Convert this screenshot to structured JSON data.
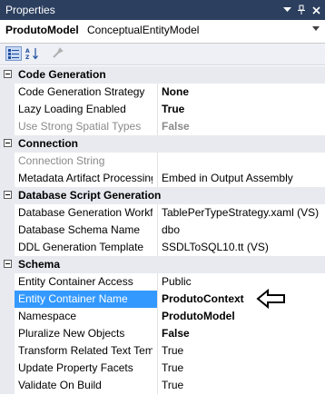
{
  "window": {
    "title": "Properties",
    "icons": [
      "dropdown-icon",
      "pin-icon",
      "close-icon"
    ]
  },
  "object": {
    "name": "ProdutoModel",
    "type": "ConceptualEntityModel"
  },
  "toolbar": {
    "buttons": [
      "categorized-icon",
      "alphabetical-icon",
      "property-pages-icon"
    ]
  },
  "categories": [
    {
      "label": "Code Generation",
      "props": [
        {
          "name": "Code Generation Strategy",
          "value": "None",
          "bold": true
        },
        {
          "name": "Lazy Loading Enabled",
          "value": "True",
          "bold": true
        },
        {
          "name": "Use Strong Spatial Types",
          "value": "False",
          "bold": true,
          "disabled": true
        }
      ]
    },
    {
      "label": "Connection",
      "props": [
        {
          "name": "Connection String",
          "value": "",
          "disabled": true
        },
        {
          "name": "Metadata Artifact Processing",
          "value": "Embed in Output Assembly"
        }
      ]
    },
    {
      "label": "Database Script Generation",
      "props": [
        {
          "name": "Database Generation Workflo",
          "value": "TablePerTypeStrategy.xaml (VS)"
        },
        {
          "name": "Database Schema Name",
          "value": "dbo"
        },
        {
          "name": "DDL Generation Template",
          "value": "SSDLToSQL10.tt (VS)"
        }
      ]
    },
    {
      "label": "Schema",
      "props": [
        {
          "name": "Entity Container Access",
          "value": "Public"
        },
        {
          "name": "Entity Container Name",
          "value": "ProdutoContext",
          "bold": true,
          "selected": true
        },
        {
          "name": "Namespace",
          "value": "ProdutoModel",
          "bold": true
        },
        {
          "name": "Pluralize New Objects",
          "value": "False",
          "bold": true
        },
        {
          "name": "Transform Related Text Temp",
          "value": "True"
        },
        {
          "name": "Update Property Facets",
          "value": "True"
        },
        {
          "name": "Validate On Build",
          "value": "True"
        }
      ]
    }
  ]
}
